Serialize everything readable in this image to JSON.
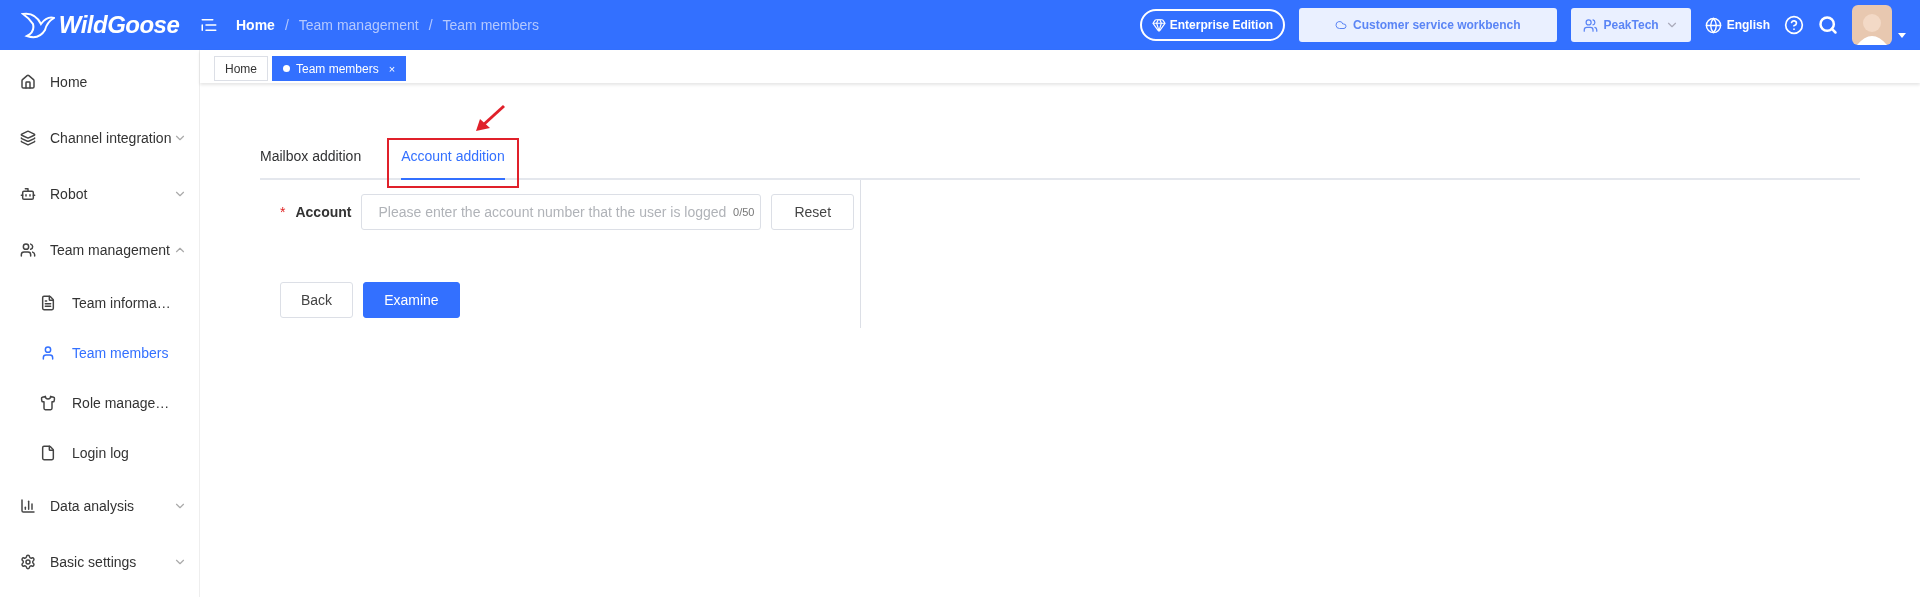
{
  "logo": {
    "text": "WildGoose"
  },
  "breadcrumb": [
    {
      "label": "Home",
      "current": true
    },
    {
      "separator": "/",
      "label": "Team management",
      "current": false
    },
    {
      "separator": "/",
      "label": "Team members",
      "current": false
    }
  ],
  "header_actions": {
    "edition": "Enterprise Edition",
    "workbench": "Customer service workbench",
    "company": "PeakTech",
    "language": "English"
  },
  "sidebar": {
    "items": [
      {
        "label": "Home",
        "selected": false
      },
      {
        "label": "Channel integration",
        "expanded": false,
        "selected": false
      },
      {
        "label": "Robot",
        "expanded": false,
        "selected": false
      },
      {
        "label": "Team management",
        "expanded": true,
        "selected": false,
        "children": [
          {
            "label": "Team informa…",
            "selected": false
          },
          {
            "label": "Team members",
            "selected": true
          },
          {
            "label": "Role manage…",
            "selected": false
          },
          {
            "label": "Login log",
            "selected": false
          }
        ]
      },
      {
        "label": "Data analysis",
        "expanded": false,
        "selected": false
      },
      {
        "label": "Basic settings",
        "expanded": false,
        "selected": false
      }
    ]
  },
  "page_tabs": [
    {
      "label": "Home",
      "selected": false
    },
    {
      "label": "Team members",
      "selected": true,
      "close": "×"
    }
  ],
  "tabs": [
    {
      "label": "Mailbox addition",
      "selected": false,
      "highlighted": false
    },
    {
      "label": "Account addition",
      "selected": true,
      "highlighted": true
    }
  ],
  "form": {
    "required_mark": "*",
    "label": "Account",
    "placeholder": "Please enter the account number that the user is logged",
    "counter": "0/50",
    "reset": "Reset",
    "back": "Back",
    "submit": "Examine"
  }
}
